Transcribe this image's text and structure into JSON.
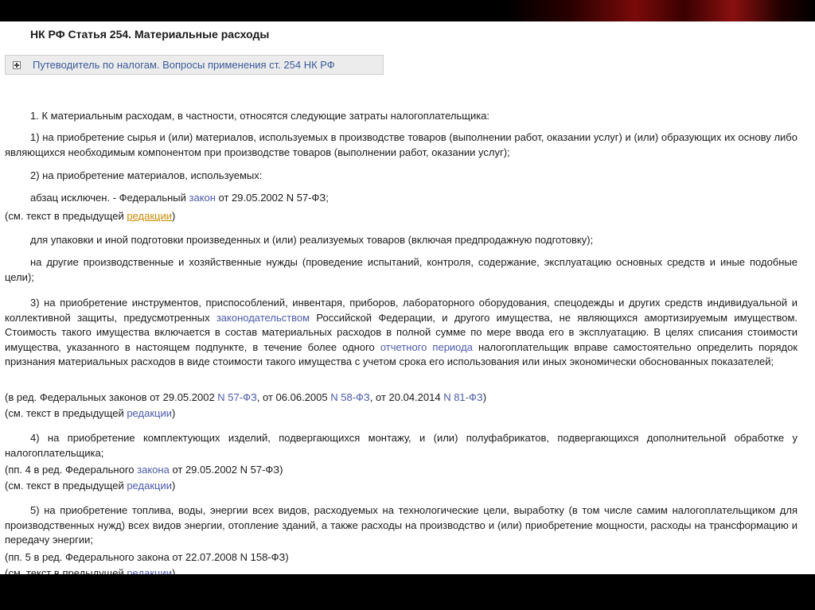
{
  "doc": {
    "title": "НК РФ Статья 254. Материальные расходы",
    "guide": "Путеводитель по налогам. Вопросы применения ст. 254 НК РФ",
    "intro": "1. К материальным расходам, в частности, относятся следующие затраты налогоплательщика:",
    "p1": "1) на приобретение сырья и (или) материалов, используемых в производстве товаров (выполнении работ, оказании услуг) и (или) образующих их основу либо являющихся необходимым компонентом при производстве товаров (выполнении работ, оказании услуг);",
    "p2": "2) на приобретение материалов, используемых:",
    "abz_a": "абзац исключен. - Федеральный ",
    "abz_link": "закон",
    "abz_b": " от 29.05.2002 N 57-ФЗ;",
    "see_a": "(см. текст в предыдущей ",
    "see_link": "редакции",
    "see_b": ")",
    "pack": "для упаковки и иной подготовки произведенных и (или) реализуемых товаров (включая предпродажную подготовку);",
    "other": "на другие производственные и хозяйственные нужды (проведение испытаний, контроля, содержание, эксплуатацию основных средств и иные подобные цели);",
    "p3_a": "3) на приобретение инструментов, приспособлений, инвентаря, приборов, лабораторного оборудования, спецодежды и других средств индивидуальной и коллективной защиты, предусмотренных ",
    "p3_link1": "законодательством",
    "p3_b": " Российской Федерации, и другого имущества, не являющихся амортизируемым имуществом. Стоимость такого имущества включается в состав материальных расходов в полной сумме по мере ввода его в эксплуатацию. В целях списания стоимости имущества, указанного в настоящем подпункте, в течение более одного ",
    "p3_link2": "отчетного периода",
    "p3_c": " налогоплательщик вправе самостоятельно определить порядок признания материальных расходов в виде стоимости такого имущества с учетом срока его использования или иных экономически обоснованных показателей;",
    "p3_red_a": "(в ред. Федеральных законов от 29.05.2002 ",
    "p3_red_l1": "N 57-ФЗ",
    "p3_red_b": ", от 06.06.2005 ",
    "p3_red_l2": "N 58-ФЗ",
    "p3_red_c": ", от 20.04.2014 ",
    "p3_red_l3": "N 81-ФЗ",
    "p3_red_d": ")",
    "p4": "4) на приобретение комплектующих изделий, подвергающихся монтажу, и (или) полуфабрикатов, подвергающихся дополнительной обработке у налогоплательщика;",
    "p4_red_a": "(пп. 4 в ред. Федерального ",
    "p4_red_link": "закона",
    "p4_red_b": " от 29.05.2002 N 57-ФЗ)",
    "p5": "5) на приобретение топлива, воды, энергии всех видов, расходуемых на технологические цели, выработку (в том числе самим налогоплательщиком для производственных нужд) всех видов энергии, отопление зданий, а также расходы на производство и (или) приобретение мощности, расходы на трансформацию и передачу энергии;",
    "p5_red": "(пп. 5 в ред. Федерального закона от 22.07.2008 N 158-ФЗ)"
  }
}
